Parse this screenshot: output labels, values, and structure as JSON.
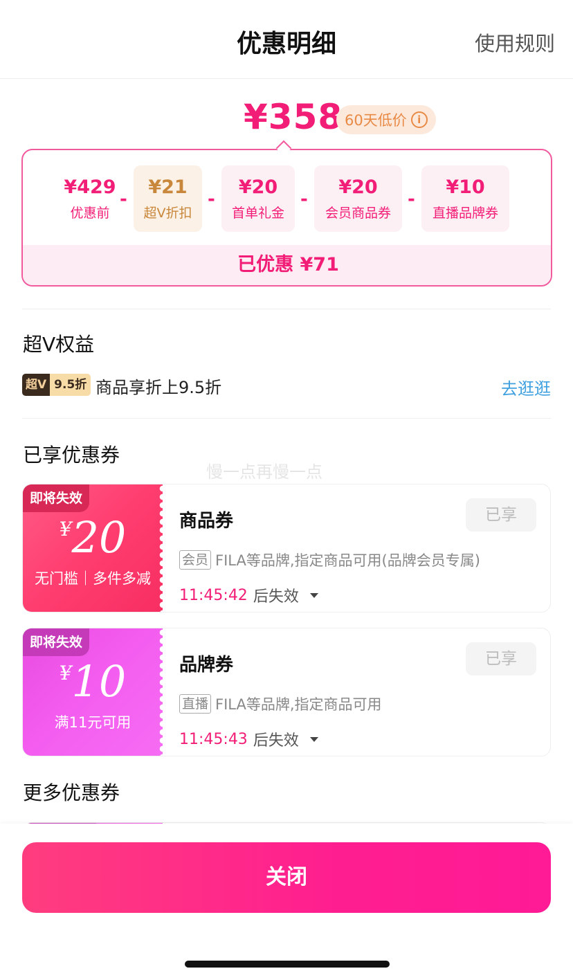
{
  "header": {
    "title": "优惠明细",
    "rules_link": "使用规则"
  },
  "price": {
    "final": "¥358",
    "low_price_tag": "60天低价",
    "info_icon": "i"
  },
  "breakdown": {
    "items": [
      {
        "amount": "¥429",
        "label": "优惠前"
      },
      {
        "amount": "¥21",
        "label": "超V折扣"
      },
      {
        "amount": "¥20",
        "label": "首单礼金"
      },
      {
        "amount": "¥20",
        "label": "会员商品券"
      },
      {
        "amount": "¥10",
        "label": "直播品牌券"
      }
    ],
    "operator": "-",
    "saved": "已优惠 ¥71"
  },
  "super_v": {
    "section_title": "超V权益",
    "badge_left": "超V",
    "badge_right": "9.5折",
    "text": "商品享折上9.5折",
    "link": "去逛逛"
  },
  "watermark": "慢一点再慢一点",
  "enjoyed": {
    "section_title": "已享优惠券",
    "coupons": [
      {
        "tag": "即将失效",
        "currency": "¥",
        "value": "20",
        "condition": "无门槛｜多件多减",
        "name": "商品券",
        "status": "已享",
        "desc_tag": "会员",
        "desc": "FILA等品牌,指定商品可用(品牌会员专属)",
        "expire_time": "11:45:42",
        "expire_suffix": "后失效"
      },
      {
        "tag": "即将失效",
        "currency": "¥",
        "value": "10",
        "condition": "满11元可用",
        "name": "品牌券",
        "status": "已享",
        "desc_tag": "直播",
        "desc": "FILA等品牌,指定商品可用",
        "expire_time": "11:45:43",
        "expire_suffix": "后失效"
      }
    ]
  },
  "more": {
    "section_title": "更多优惠券"
  },
  "footer": {
    "close_label": "关闭"
  },
  "colors": {
    "accent": "#f21d76",
    "link": "#3fa0e0",
    "gold": "#c8873a"
  }
}
